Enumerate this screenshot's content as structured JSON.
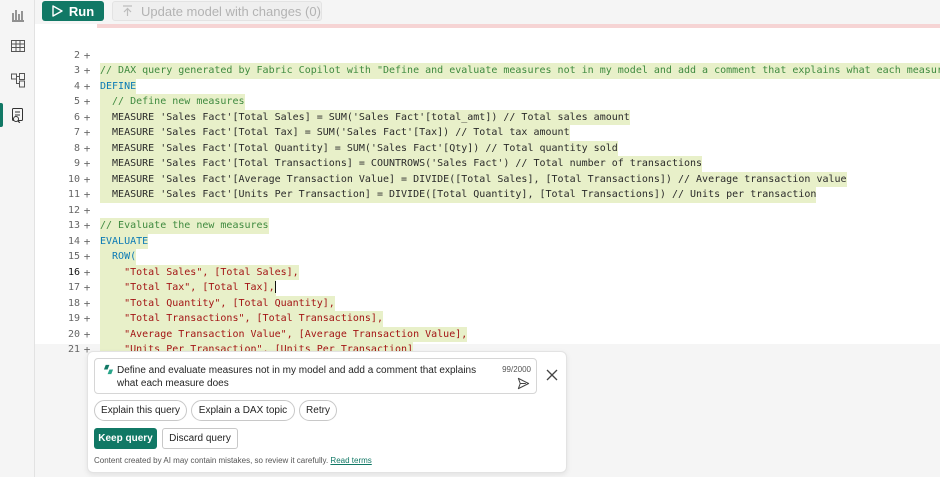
{
  "rail": {
    "items": [
      {
        "icon": "report-icon",
        "active": false
      },
      {
        "icon": "table-icon",
        "active": false
      },
      {
        "icon": "model-icon",
        "active": false
      },
      {
        "icon": "dax-query-icon",
        "active": true
      }
    ]
  },
  "toolbar": {
    "run_label": "Run",
    "update_label": "Update model with changes (0)"
  },
  "editor": {
    "lines": [
      {
        "num": "2",
        "text": "// DAX query generated by Fabric Copilot with \"Define and evaluate measures not in my model and add a comment that explains what each measure does\""
      },
      {
        "num": "3",
        "text": "DEFINE"
      },
      {
        "num": "4",
        "text": "  // Define new measures"
      },
      {
        "num": "5",
        "text": "  MEASURE 'Sales Fact'[Total Sales] = SUM('Sales Fact'[total_amt]) // Total sales amount"
      },
      {
        "num": "6",
        "text": "  MEASURE 'Sales Fact'[Total Tax] = SUM('Sales Fact'[Tax]) // Total tax amount"
      },
      {
        "num": "7",
        "text": "  MEASURE 'Sales Fact'[Total Quantity] = SUM('Sales Fact'[Qty]) // Total quantity sold"
      },
      {
        "num": "8",
        "text": "  MEASURE 'Sales Fact'[Total Transactions] = COUNTROWS('Sales Fact') // Total number of transactions"
      },
      {
        "num": "9",
        "text": "  MEASURE 'Sales Fact'[Average Transaction Value] = DIVIDE([Total Sales], [Total Transactions]) // Average transaction value"
      },
      {
        "num": "10",
        "text": "  MEASURE 'Sales Fact'[Units Per Transaction] = DIVIDE([Total Quantity], [Total Transactions]) // Units per transaction"
      },
      {
        "num": "11",
        "text": ""
      },
      {
        "num": "12",
        "text": "// Evaluate the new measures"
      },
      {
        "num": "13",
        "text": "EVALUATE"
      },
      {
        "num": "14",
        "text": "  ROW("
      },
      {
        "num": "15",
        "text": "    \"Total Sales\", [Total Sales],"
      },
      {
        "num": "16",
        "text": "    \"Total Tax\", [Total Tax],"
      },
      {
        "num": "17",
        "text": "    \"Total Quantity\", [Total Quantity],"
      },
      {
        "num": "18",
        "text": "    \"Total Transactions\", [Total Transactions],"
      },
      {
        "num": "19",
        "text": "    \"Average Transaction Value\", [Average Transaction Value],"
      },
      {
        "num": "20",
        "text": "    \"Units Per Transaction\", [Units Per Transaction]"
      },
      {
        "num": "21",
        "text": "  )"
      }
    ],
    "current_line": "16"
  },
  "copilot": {
    "prompt": "Define and evaluate measures not in my model and add a comment that explains what each measure does",
    "char_count": "99/2000",
    "suggestions": [
      "Explain this query",
      "Explain a DAX topic",
      "Retry"
    ],
    "keep_label": "Keep query",
    "discard_label": "Discard query",
    "disclaimer": "Content created by AI may contain mistakes, so review it carefully.",
    "read_terms": "Read terms",
    "accent": "#117865"
  }
}
